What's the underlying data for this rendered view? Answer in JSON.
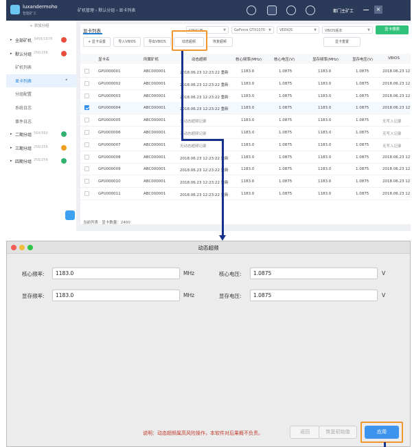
{
  "app": {
    "brand": "luxandermoho",
    "brand_sub": "智能矿工",
    "breadcrumb": "矿机管理 › 默认分组 › 显卡列表",
    "user": "都门主矿工",
    "close_glyph": "×"
  },
  "sidebar": {
    "add_group": "+ 添加分组",
    "items": [
      {
        "label": "全部矿机",
        "count": "3456/1678",
        "dot": "#e84c3d",
        "level": 0
      },
      {
        "label": "默认分组",
        "count": "256/256",
        "dot": "#e84c3d",
        "level": 0
      },
      {
        "label": "矿机列表",
        "count": "",
        "dot": "",
        "level": 1
      },
      {
        "label": "显卡列表",
        "count": "",
        "dot": "",
        "level": 1,
        "active": true
      },
      {
        "label": "分组配置",
        "count": "",
        "dot": "",
        "level": 1
      },
      {
        "label": "系统日志",
        "count": "",
        "dot": "",
        "level": 1
      },
      {
        "label": "事件日志",
        "count": "",
        "dot": "",
        "level": 1
      },
      {
        "label": "二期分组",
        "count": "564/560",
        "dot": "#2fb36f",
        "level": 0
      },
      {
        "label": "三期分组",
        "count": "256/256",
        "dot": "#f0a020",
        "level": 0
      },
      {
        "label": "四期分组",
        "count": "256/256",
        "dot": "#2fb36f",
        "level": 0
      }
    ]
  },
  "panel": {
    "tab": "显卡列表",
    "filters": [
      "GPU厂商",
      "GeForce GTX1070",
      "VEDIOS",
      "VBIOS版本"
    ],
    "search_button": "显卡搜索",
    "actions": [
      "+ 显卡设置",
      "导入VBIOS",
      "导出VBIOS",
      "动态超频",
      "恢复超频"
    ],
    "reset_search": "显卡重置",
    "columns": [
      "显卡名",
      "所属矿机",
      "动态超频",
      "核心频率(MHz)",
      "核心电压(V)",
      "显存频率(MHz)",
      "显存电压(V)",
      "VBIOS"
    ],
    "rows": [
      {
        "name": "GPU000001",
        "miner": "ABC000001",
        "oc": "2018.06.23 12:23:22 重新",
        "core": "1183.0",
        "cv": "1.0875",
        "mem": "1183.0",
        "mv": "1.0875",
        "vbios": "2018.06.23 12",
        "checked": false
      },
      {
        "name": "GPU000002",
        "miner": "ABC000001",
        "oc": "2018.06.23 12:23:22 重新",
        "core": "1183.0",
        "cv": "1.0875",
        "mem": "1183.0",
        "mv": "1.0875",
        "vbios": "2018.06.23 12",
        "checked": false
      },
      {
        "name": "GPU000003",
        "miner": "ABC000001",
        "oc": "2018.06.23 12:23:22 重新",
        "core": "1183.0",
        "cv": "1.0875",
        "mem": "1183.0",
        "mv": "1.0875",
        "vbios": "2018.06.23 12",
        "checked": false
      },
      {
        "name": "GPU000004",
        "miner": "ABC000001",
        "oc": "2018.06.23 12:23:22 重新",
        "core": "1183.0",
        "cv": "1.0875",
        "mem": "1183.0",
        "mv": "1.0875",
        "vbios": "2018.06.23 12",
        "checked": true
      },
      {
        "name": "GPU000005",
        "miner": "ABC000001",
        "oc": "无动态超频记录",
        "core": "1183.0",
        "cv": "1.0875",
        "mem": "1183.0",
        "mv": "1.0875",
        "vbios": "无写入记录",
        "checked": false
      },
      {
        "name": "GPU000006",
        "miner": "ABC000001",
        "oc": "无动态超频记录",
        "core": "1183.0",
        "cv": "1.0875",
        "mem": "1183.0",
        "mv": "1.0875",
        "vbios": "无写入记录",
        "checked": false
      },
      {
        "name": "GPU000007",
        "miner": "ABC000001",
        "oc": "无动态超频记录",
        "core": "1183.0",
        "cv": "1.0875",
        "mem": "1183.0",
        "mv": "1.0875",
        "vbios": "无写入记录",
        "checked": false
      },
      {
        "name": "GPU000008",
        "miner": "ABC000001",
        "oc": "2018.06.23 12:23:22 重新",
        "core": "1183.0",
        "cv": "1.0875",
        "mem": "1183.0",
        "mv": "1.0875",
        "vbios": "2018.06.23 12",
        "checked": false
      },
      {
        "name": "GPU000009",
        "miner": "ABC000001",
        "oc": "2018.06.23 12:23:22 重新",
        "core": "1183.0",
        "cv": "1.0875",
        "mem": "1183.0",
        "mv": "1.0875",
        "vbios": "2018.06.23 12",
        "checked": false
      },
      {
        "name": "GPU000010",
        "miner": "ABC000001",
        "oc": "2018.06.23 12:23:22 重新",
        "core": "1183.0",
        "cv": "1.0875",
        "mem": "1183.0",
        "mv": "1.0875",
        "vbios": "2018.06.23 12",
        "checked": false
      },
      {
        "name": "GPU000011",
        "miner": "ABC000001",
        "oc": "2018.06.23 12:23:22 重新",
        "core": "1183.0",
        "cv": "1.0875",
        "mem": "1183.0",
        "mv": "1.0875",
        "vbios": "2018.06.23 12",
        "checked": false
      }
    ],
    "footer": "当前列表 · 显卡数量：2400"
  },
  "dialog": {
    "title": "动态超频",
    "core_freq_label": "核心频率:",
    "core_freq_value": "1183.0",
    "core_freq_unit": "MHz",
    "core_volt_label": "核心电压:",
    "core_volt_value": "1.0875",
    "core_volt_unit": "V",
    "mem_freq_label": "显存频率:",
    "mem_freq_value": "1183.0",
    "mem_freq_unit": "MHz",
    "mem_volt_label": "显存电压:",
    "mem_volt_value": "1.0875",
    "mem_volt_unit": "V",
    "note": "说明：动态超频属高风险操作，本软件对后果概不负责。",
    "back_button": "返回",
    "restore_button": "恢复初始值",
    "apply_button": "应用"
  },
  "colors": {
    "titlebar": "#2b3a58",
    "accent": "#1e7fd6",
    "highlight": "#f0962e",
    "connector": "#15318c",
    "search_green": "#30c27a",
    "apply_blue": "#3d94ee",
    "note_red": "#c0392b"
  }
}
